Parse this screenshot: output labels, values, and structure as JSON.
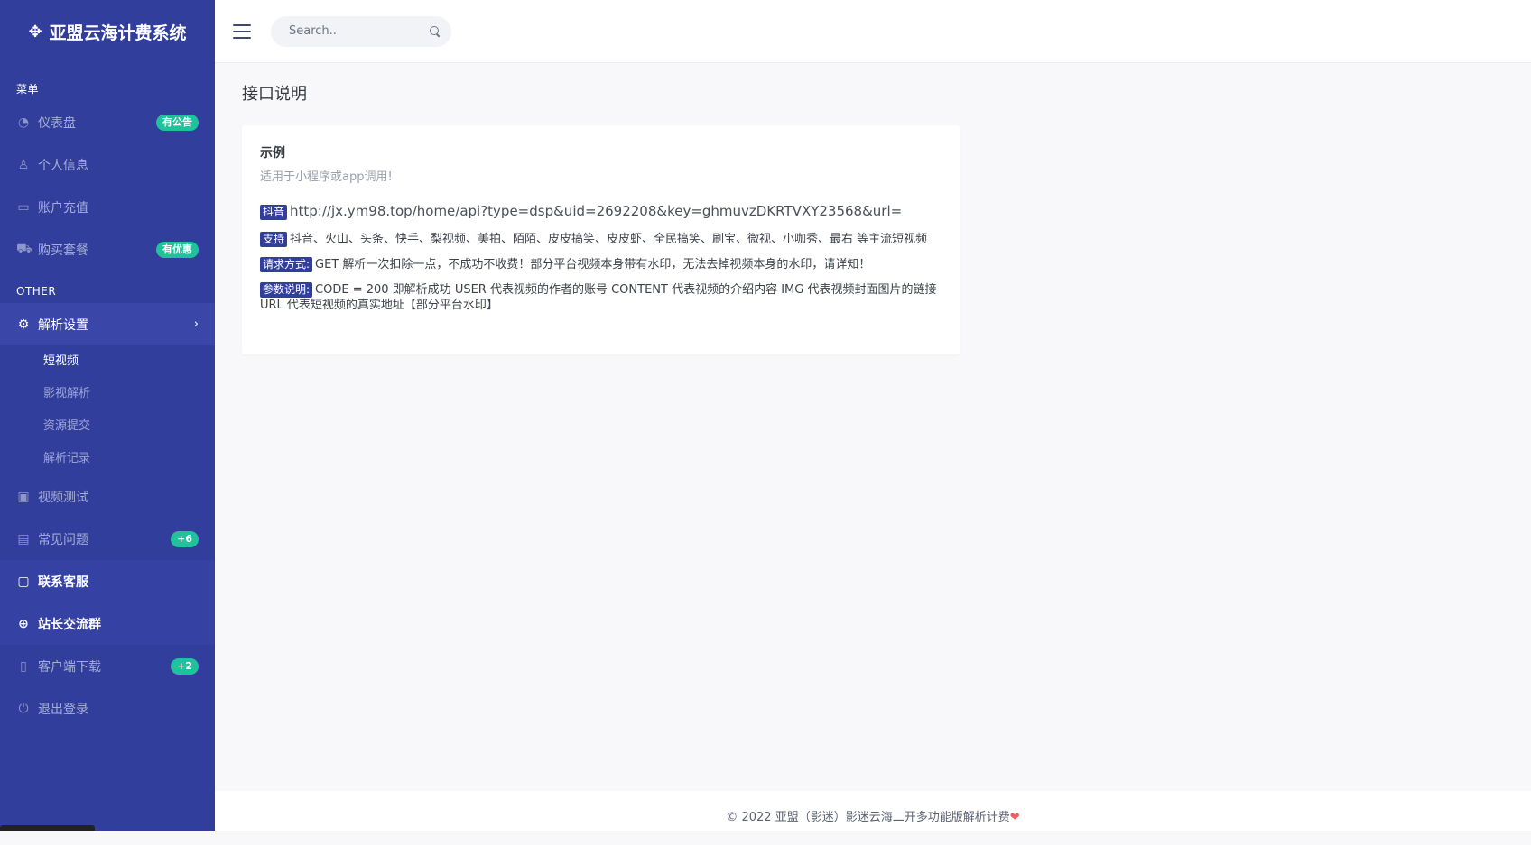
{
  "brand": {
    "icon": "✥",
    "title": "亚盟云海计费系统"
  },
  "header": {
    "search_placeholder": "Search.."
  },
  "sidebar": {
    "menu_title": "菜单",
    "other_title": "OTHER",
    "items": [
      {
        "label": "仪表盘",
        "icon": "dashboard-icon",
        "badge": "有公告"
      },
      {
        "label": "个人信息",
        "icon": "user-icon"
      },
      {
        "label": "账户充值",
        "icon": "credit-card-icon"
      },
      {
        "label": "购买套餐",
        "icon": "cart-icon",
        "badge": "有优惠"
      }
    ],
    "parse_settings": {
      "label": "解析设置",
      "icon": "gear-icon",
      "chevron": "›",
      "sub_items": [
        "短视频",
        "影视解析",
        "资源提交",
        "解析记录"
      ]
    },
    "items2": [
      {
        "label": "视频测试",
        "icon": "video-icon"
      },
      {
        "label": "常见问题",
        "icon": "book-icon",
        "badge": "+6"
      },
      {
        "label": "联系客服",
        "icon": "chat-icon"
      },
      {
        "label": "站长交流群",
        "icon": "plus-circle-icon"
      },
      {
        "label": "客户端下载",
        "icon": "file-icon",
        "badge": "+2"
      },
      {
        "label": "退出登录",
        "icon": "power-icon"
      }
    ]
  },
  "main": {
    "page_title": "接口说明",
    "card": {
      "title": "示例",
      "subtitle": "适用于小程序或app调用!",
      "url_tag": "抖音",
      "url": "http://jx.ym98.top/home/api?type=dsp&uid=2692208&key=ghmuvzDKRTVXY23568&url=",
      "support_tag": "支持",
      "support_text": "抖音、火山、头条、快手、梨视频、美拍、陌陌、皮皮搞笑、皮皮虾、全民搞笑、刷宝、微视、小咖秀、最右 等主流短视频",
      "method_tag": "请求方式:",
      "method_text": "GET 解析一次扣除一点，不成功不收费！部分平台视频本身带有水印，无法去掉视频本身的水印，请详知！",
      "params_tag": "参数说明:",
      "params_text": "CODE = 200 即解析成功 USER 代表视频的作者的账号 CONTENT 代表视频的介绍内容 IMG 代表视频封面图片的链接 URL 代表短视频的真实地址【部分平台水印】"
    }
  },
  "footer": {
    "text": "© 2022 亚盟（影迷）影迷云海二开多功能版解析计费",
    "heart": "❤"
  },
  "colors": {
    "sidebar_bg": "#323e9c",
    "badge": "#1fc29a",
    "tag_bg": "#323e9c"
  }
}
